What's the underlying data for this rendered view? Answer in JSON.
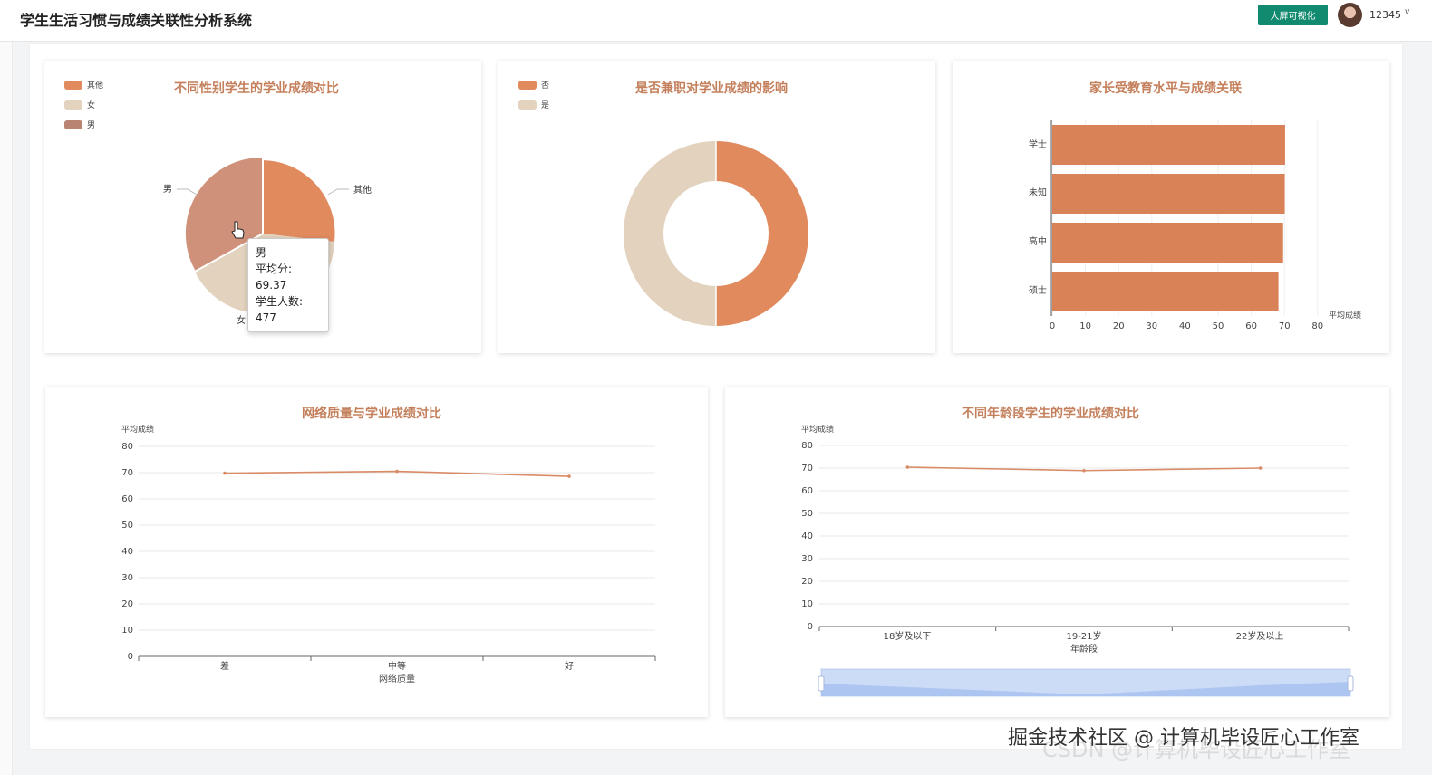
{
  "header": {
    "title": "学生生活习惯与成绩关联性分析系统",
    "bigscreen_label": "大屏可视化",
    "username": "12345",
    "caret": "∨"
  },
  "colors": {
    "accent": "#e08a5e",
    "beige": "#e2d2be",
    "brown": "#c88e78",
    "title": "#c4805c",
    "button": "#118a6f"
  },
  "charts": {
    "gender": {
      "title": "不同性别学生的学业成绩对比",
      "legend": [
        "其他",
        "女",
        "男"
      ],
      "slice_labels": {
        "other": "其他",
        "female": "女",
        "male": "男"
      },
      "tooltip": {
        "name": "男",
        "line1": "平均分: 69.37",
        "line2": "学生人数: 477"
      }
    },
    "parttime": {
      "title": "是否兼职对学业成绩的影响",
      "legend": [
        "否",
        "是"
      ]
    },
    "education": {
      "title": "家长受教育水平与成绩关联",
      "categories": [
        "学士",
        "未知",
        "高中",
        "硕士"
      ],
      "x_ticks": [
        "0",
        "10",
        "20",
        "30",
        "40",
        "50",
        "60",
        "70",
        "80"
      ],
      "axis_name": "平均成绩"
    },
    "internet": {
      "title": "网络质量与学业成绩对比",
      "y_name": "平均成绩",
      "x_name": "网络质量",
      "categories": [
        "差",
        "中等",
        "好"
      ],
      "y_ticks": [
        "0",
        "10",
        "20",
        "30",
        "40",
        "50",
        "60",
        "70",
        "80"
      ]
    },
    "age": {
      "title": "不同年龄段学生的学业成绩对比",
      "y_name": "平均成绩",
      "x_name": "年龄段",
      "categories": [
        "18岁及以下",
        "19-21岁",
        "22岁及以上"
      ],
      "y_ticks": [
        "0",
        "10",
        "20",
        "30",
        "40",
        "50",
        "60",
        "70",
        "80"
      ]
    }
  },
  "chart_data": [
    {
      "type": "pie",
      "title": "不同性别学生的学业成绩对比",
      "categories": [
        "其他",
        "女",
        "男"
      ],
      "values": [
        34,
        33,
        33
      ]
    },
    {
      "type": "pie",
      "title": "是否兼职对学业成绩的影响",
      "categories": [
        "否",
        "是"
      ],
      "values": [
        50,
        50
      ]
    },
    {
      "type": "bar",
      "title": "家长受教育水平与成绩关联",
      "categories": [
        "学士",
        "未知",
        "高中",
        "硕士"
      ],
      "values": [
        70.2,
        70.1,
        69.6,
        68.2
      ],
      "xlim": [
        0,
        80
      ],
      "xlabel": "平均成绩"
    },
    {
      "type": "line",
      "title": "网络质量与学业成绩对比",
      "categories": [
        "差",
        "中等",
        "好"
      ],
      "values": [
        69.8,
        70.5,
        68.6
      ],
      "ylim": [
        0,
        80
      ],
      "xlabel": "网络质量",
      "ylabel": "平均成绩"
    },
    {
      "type": "line",
      "title": "不同年龄段学生的学业成绩对比",
      "categories": [
        "18岁及以下",
        "19-21岁",
        "22岁及以上"
      ],
      "values": [
        70.4,
        68.9,
        70.0
      ],
      "ylim": [
        0,
        80
      ],
      "xlabel": "年龄段",
      "ylabel": "平均成绩"
    }
  ],
  "watermark": "掘金技术社区 @ 计算机毕设匠心工作室",
  "watermark_csdn": "CSDN @计算机毕设匠心工作室"
}
